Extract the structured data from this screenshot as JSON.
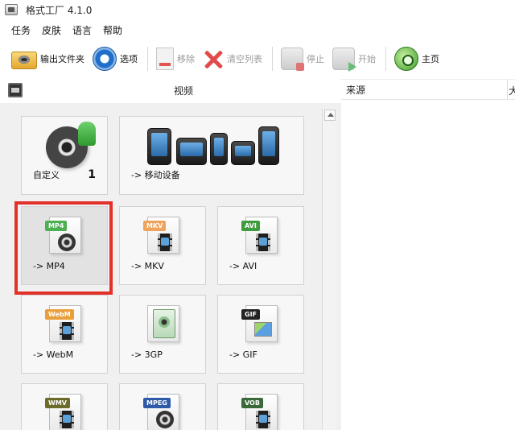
{
  "window": {
    "title": "格式工厂 4.1.0"
  },
  "menu": {
    "items": [
      "任务",
      "皮肤",
      "语言",
      "帮助"
    ]
  },
  "toolbar": {
    "output_folder": "输出文件夹",
    "options": "选项",
    "remove": "移除",
    "clear_list": "清空列表",
    "stop": "停止",
    "start": "开始",
    "home": "主页"
  },
  "left_panel": {
    "header": "视频",
    "tiles": {
      "custom": {
        "label": "自定义",
        "count": "1"
      },
      "mobile": {
        "label": "-> 移动设备"
      },
      "mp4": {
        "label": "-> MP4",
        "tag": "MP4",
        "tag_color": "#4caf50"
      },
      "mkv": {
        "label": "-> MKV",
        "tag": "MKV",
        "tag_color": "#f0a35a"
      },
      "avi": {
        "label": "-> AVI",
        "tag": "AVI",
        "tag_color": "#3e9b3e"
      },
      "webm": {
        "label": "-> WebM",
        "tag": "WebM",
        "tag_color": "#e9a03c"
      },
      "3gp": {
        "label": "-> 3GP"
      },
      "gif": {
        "label": "-> GIF",
        "tag": "GIF",
        "tag_color": "#222222"
      },
      "wmv": {
        "tag": "WMV",
        "tag_color": "#6b6b2a"
      },
      "mpeg": {
        "tag": "MPEG",
        "tag_color": "#2e5aa8"
      },
      "vob": {
        "tag": "VOB",
        "tag_color": "#3a6a3a"
      }
    },
    "selected_tile": "mp4",
    "highlight_color": "#e2302b"
  },
  "right_panel": {
    "columns": [
      "来源",
      "大"
    ]
  }
}
